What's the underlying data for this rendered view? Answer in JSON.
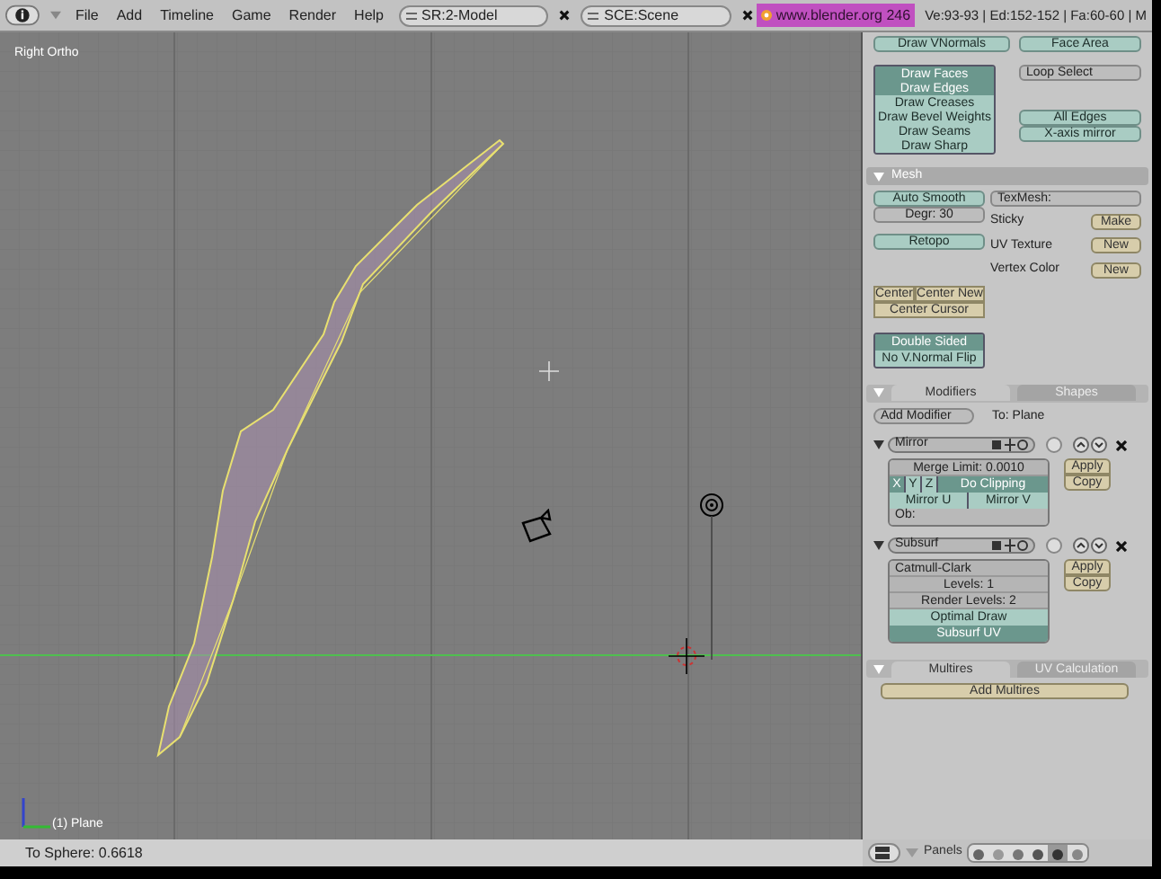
{
  "menu_bar": {
    "menus": [
      "File",
      "Add",
      "Timeline",
      "Game",
      "Render",
      "Help"
    ],
    "screen": "SR:2-Model",
    "scene": "SCE:Scene",
    "link": "www.blender.org 246",
    "stats": "Ve:93-93 | Ed:152-152 | Fa:60-60 | M"
  },
  "viewport": {
    "view_label": "Right Ortho",
    "object_label": "(1) Plane"
  },
  "mesh_tools": {
    "top_buttons": [
      "Draw VNormals",
      "Face Area"
    ],
    "draw_options": [
      {
        "label": "Draw Faces",
        "on": true
      },
      {
        "label": "Draw Edges",
        "on": true
      },
      {
        "label": "Draw Creases",
        "on": false
      },
      {
        "label": "Draw Bevel Weights",
        "on": false
      },
      {
        "label": "Draw Seams",
        "on": false
      },
      {
        "label": "Draw Sharp",
        "on": false
      }
    ],
    "loop_select": "Loop Select",
    "edge_options": [
      "All Edges",
      "X-axis mirror"
    ]
  },
  "mesh_panel": {
    "title": "Mesh",
    "auto_smooth": "Auto Smooth",
    "degree": "Degr: 30",
    "retopo": "Retopo",
    "texmesh": "TexMesh:",
    "data_rows": [
      {
        "label": "Sticky",
        "button": "Make"
      },
      {
        "label": "UV Texture",
        "button": "New"
      },
      {
        "label": "Vertex Color",
        "button": "New"
      }
    ],
    "center_buttons": [
      "Center",
      "Center New",
      "Center Cursor"
    ],
    "toggles": [
      {
        "label": "Double Sided",
        "on": true
      },
      {
        "label": "No V.Normal Flip",
        "on": false
      }
    ]
  },
  "modifiers_panel": {
    "tabs": [
      {
        "label": "Modifiers",
        "selected": true
      },
      {
        "label": "Shapes",
        "selected": false
      }
    ],
    "add_modifier": "Add Modifier",
    "target": "To: Plane",
    "modifiers": [
      {
        "kind": "mirror",
        "name": "Mirror",
        "apply": "Apply",
        "copy": "Copy",
        "merge_limit": "Merge Limit: 0.0010",
        "axes": [
          {
            "label": "X",
            "on": true
          },
          {
            "label": "Y",
            "on": false
          },
          {
            "label": "Z",
            "on": false
          }
        ],
        "clipping": {
          "label": "Do Clipping",
          "on": true
        },
        "mirror_u": "Mirror U",
        "mirror_v": "Mirror V",
        "object": "Ob:"
      },
      {
        "kind": "subsurf",
        "name": "Subsurf",
        "apply": "Apply",
        "copy": "Copy",
        "type": "Catmull-Clark",
        "levels": "Levels: 1",
        "render_levels": "Render Levels: 2",
        "toggles": [
          {
            "label": "Optimal Draw",
            "on": false
          },
          {
            "label": "Subsurf UV",
            "on": true
          }
        ]
      }
    ]
  },
  "multires_panel": {
    "tabs": [
      {
        "label": "Multires",
        "selected": true
      },
      {
        "label": "UV Calculation",
        "selected": false
      }
    ],
    "add_multires": "Add Multires"
  },
  "buttons_header": {
    "panels_label": "Panels"
  },
  "status_bar": {
    "text": "To Sphere: 0.6618"
  }
}
